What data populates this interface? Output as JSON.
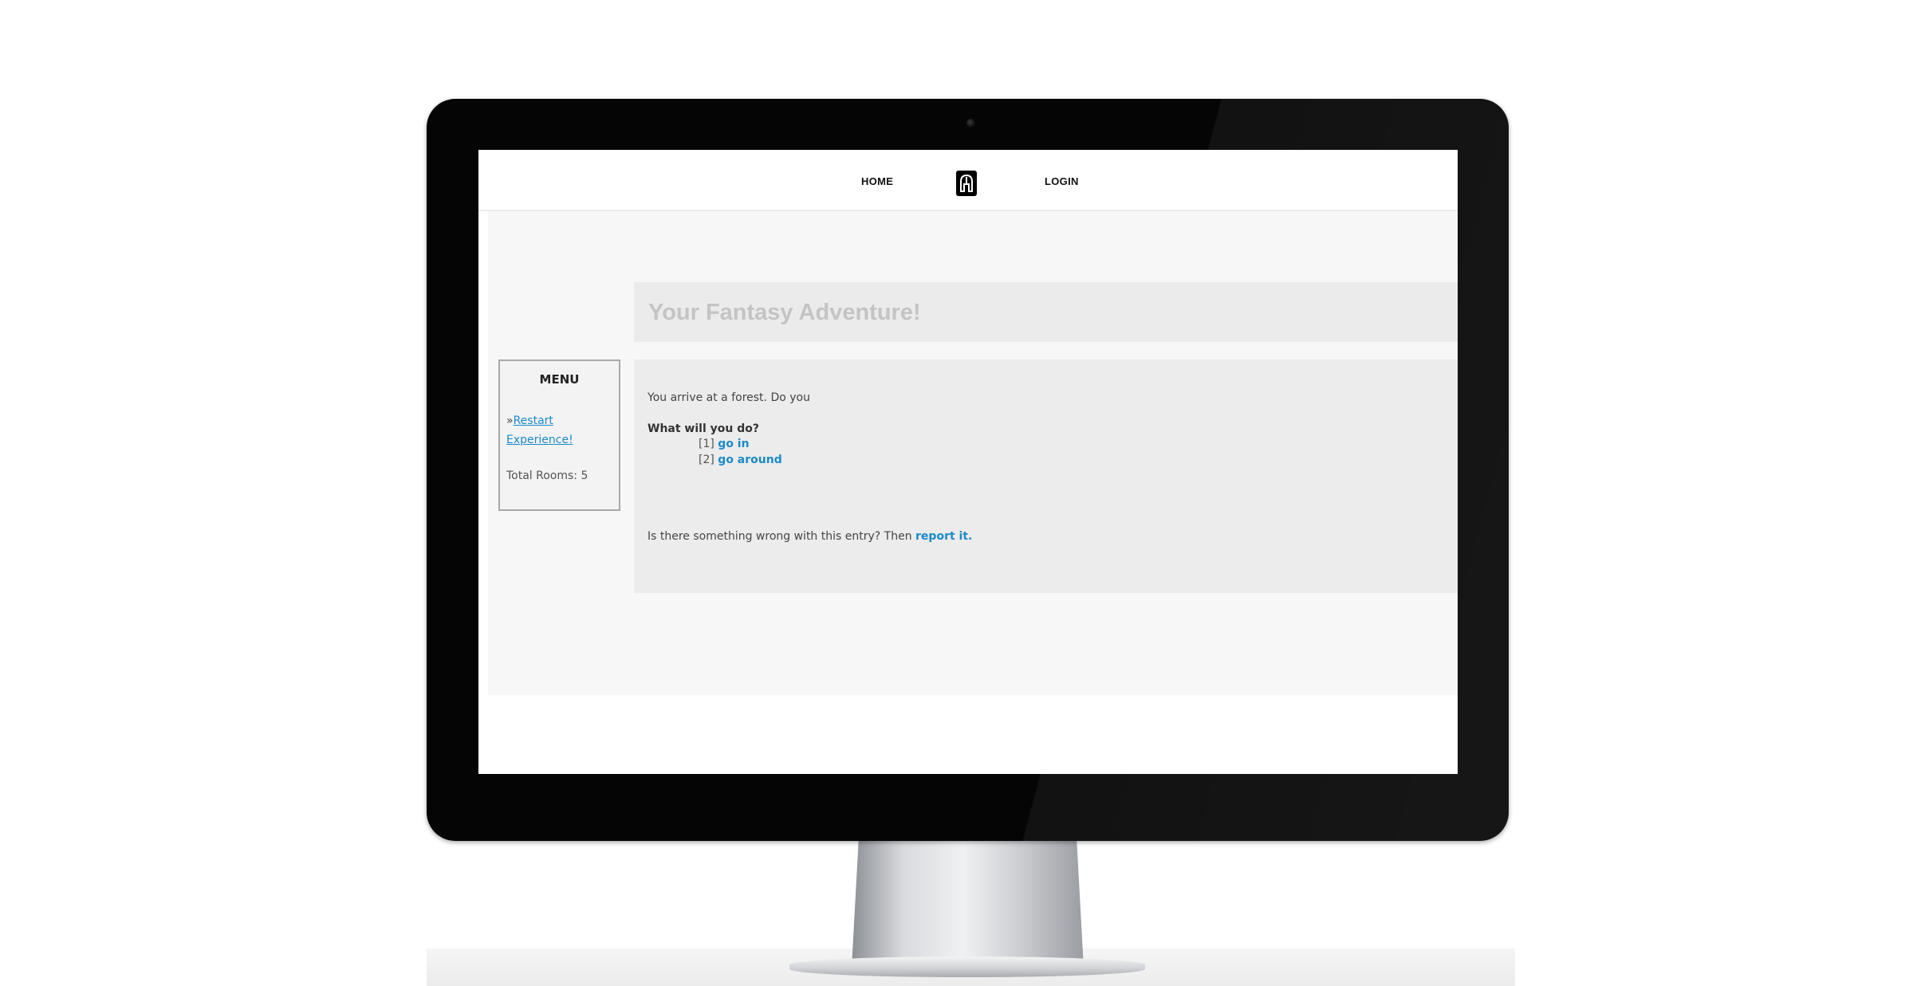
{
  "nav": {
    "home_label": "HOME",
    "login_label": "LOGIN",
    "logo_icon": "helmet-logo-icon"
  },
  "page": {
    "title": "Your Fantasy Adventure!"
  },
  "menu": {
    "title": "MENU",
    "bullet": "»",
    "restart_label": "Restart Experience!",
    "total_rooms": "Total Rooms: 5"
  },
  "entry": {
    "text": "You arrive at a forest. Do you",
    "question": "What will you do?",
    "choices": [
      {
        "number": "[1]",
        "label": "go in"
      },
      {
        "number": "[2]",
        "label": "go around"
      }
    ],
    "report_prefix": "Is there something wrong with this entry? Then",
    "report_link": "report it."
  },
  "colors": {
    "link": "#1b8ac9",
    "bezel": "#050505",
    "title_band": "#ebebeb",
    "title_text": "#c4c4c4"
  }
}
